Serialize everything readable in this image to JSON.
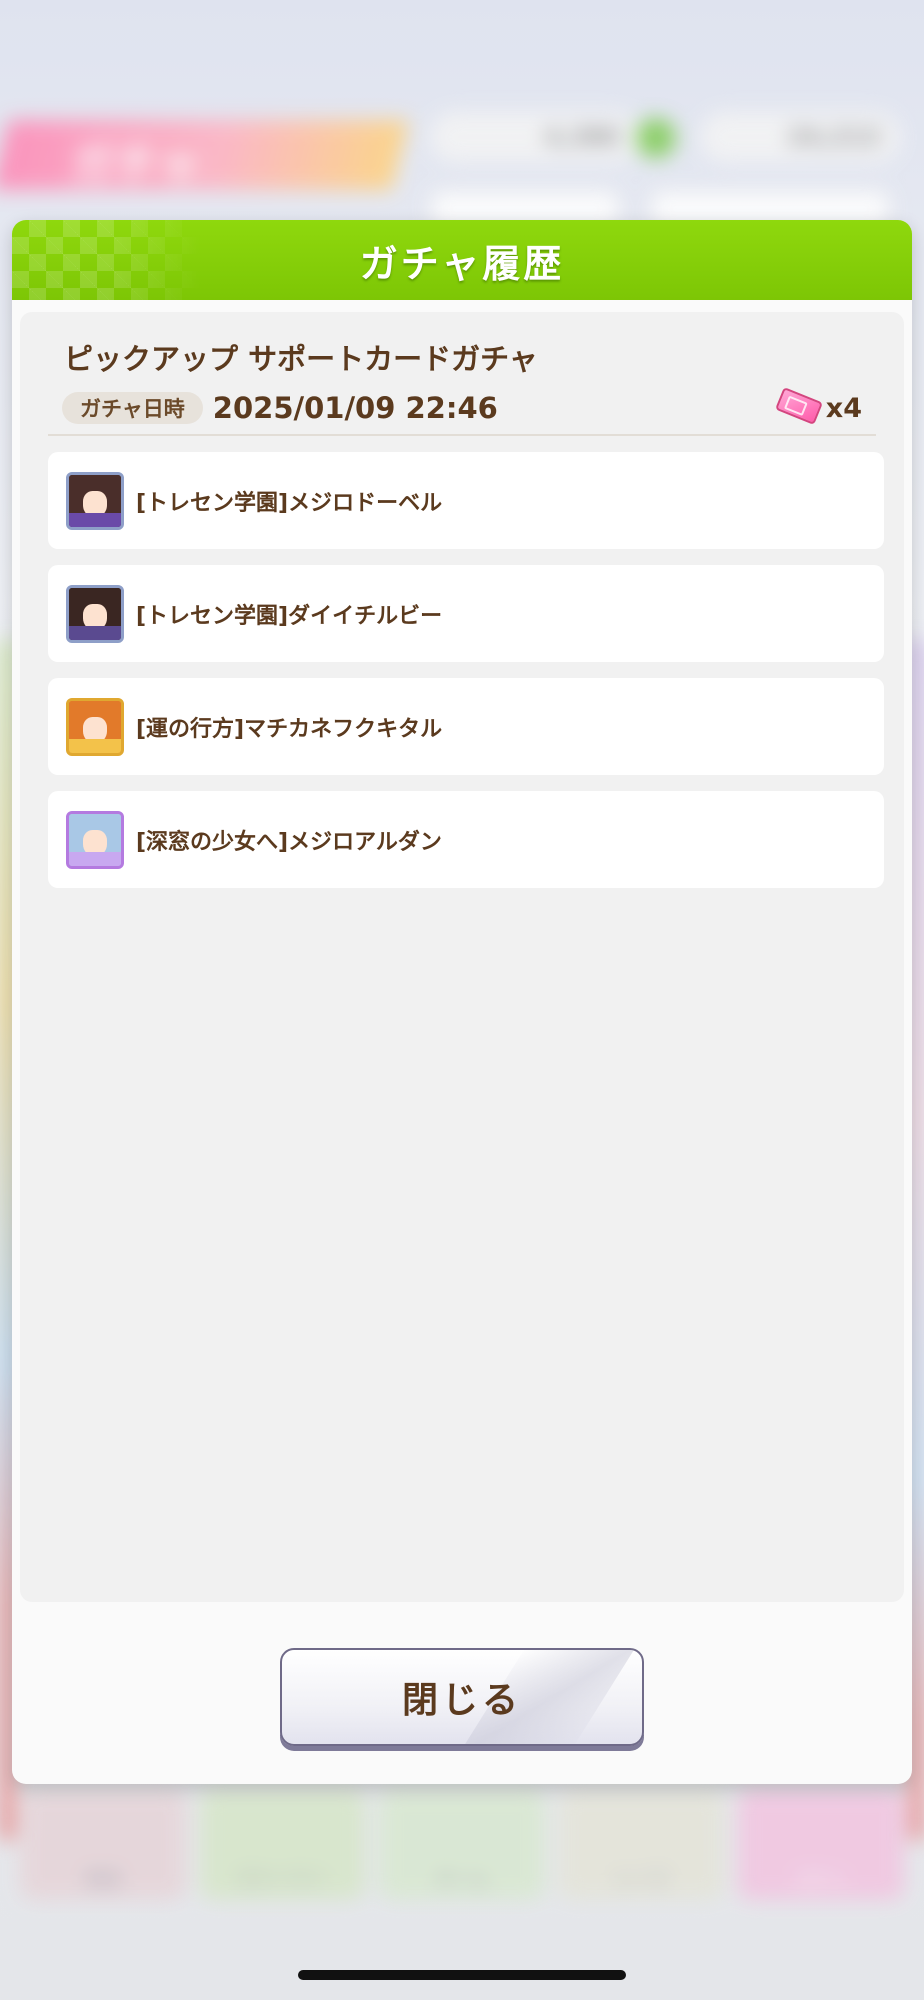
{
  "background": {
    "screen_title": "ガチャ",
    "currency": [
      {
        "value": "4,380"
      },
      {
        "value": "24,213"
      }
    ],
    "bottom_nav": [
      "育成",
      "ストーリー",
      "ホーム",
      "レース",
      "ガチャ"
    ]
  },
  "dialog": {
    "title": "ガチャ履歴",
    "gacha_name": "ピックアップ サポートカードガチャ",
    "date_label": "ガチャ日時",
    "date_value": "2025/01/09 22:46",
    "ticket_count": "x4",
    "cards": [
      {
        "name": "[トレセン学園]メジロドーベル",
        "frame_color": "#8e9fc8",
        "hair_color": "#4a2e2a",
        "cloth_color": "#6a4aa8"
      },
      {
        "name": "[トレセン学園]ダイイチルビー",
        "frame_color": "#8e9fc8",
        "hair_color": "#3a2622",
        "cloth_color": "#5a4a90"
      },
      {
        "name": "[運の行方]マチカネフクキタル",
        "frame_color": "#e0a830",
        "hair_color": "#e27a2a",
        "cloth_color": "#f3c24a"
      },
      {
        "name": "[深窓の少女へ]メジロアルダン",
        "frame_color": "#b47ae0",
        "hair_color": "#a9c8e6",
        "cloth_color": "#c8a8f0"
      }
    ],
    "close_button_label": "閉じる"
  },
  "colors": {
    "header_green": "#7dc605",
    "text_brown": "#5b3a1e",
    "ticket_pink": "#ff5cab"
  }
}
